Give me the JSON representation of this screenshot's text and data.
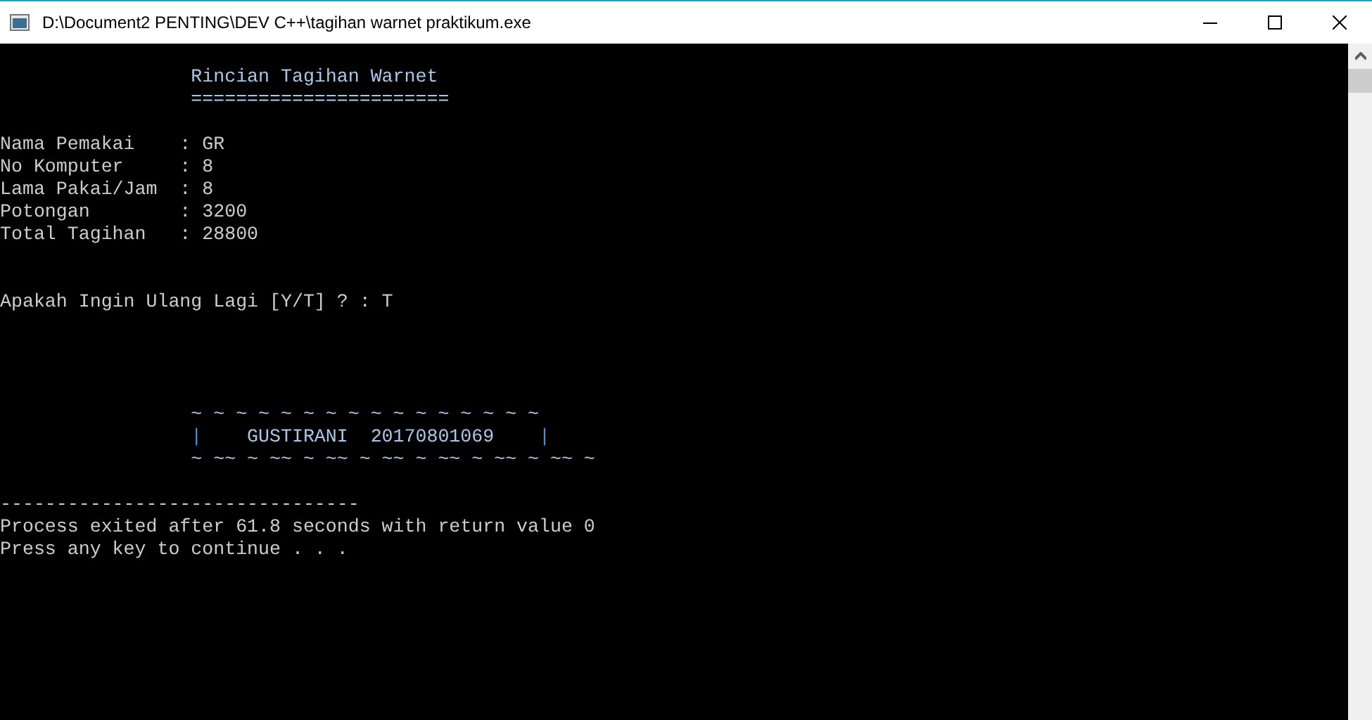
{
  "window": {
    "title": "D:\\Document2 PENTING\\DEV C++\\tagihan warnet praktikum.exe"
  },
  "console": {
    "lines": [
      {
        "kind": "blank"
      },
      {
        "kind": "heading",
        "text": "                 Rincian Tagihan Warnet"
      },
      {
        "kind": "heading",
        "text": "                 ======================="
      },
      {
        "kind": "blank"
      },
      {
        "kind": "text",
        "text": "Nama Pemakai    : GR"
      },
      {
        "kind": "text",
        "text": "No Komputer     : 8"
      },
      {
        "kind": "text",
        "text": "Lama Pakai/Jam  : 8"
      },
      {
        "kind": "text",
        "text": "Potongan        : 3200"
      },
      {
        "kind": "text",
        "text": "Total Tagihan   : 28800"
      },
      {
        "kind": "blank"
      },
      {
        "kind": "blank"
      },
      {
        "kind": "text",
        "text": "Apakah Ingin Ulang Lagi [Y/T] ? : T"
      },
      {
        "kind": "blank"
      },
      {
        "kind": "blank"
      },
      {
        "kind": "blank"
      },
      {
        "kind": "blank"
      },
      {
        "kind": "heading",
        "text": "                 ~ ~ ~ ~ ~ ~ ~ ~ ~ ~ ~ ~ ~ ~ ~ ~"
      },
      {
        "kind": "framed",
        "left": "|",
        "text": "    GUSTIRANI  20170801069    ",
        "right": "|"
      },
      {
        "kind": "heading",
        "text": "                 ~ ~~ ~ ~~ ~ ~~ ~ ~~ ~ ~~ ~ ~~ ~ ~~ ~"
      },
      {
        "kind": "blank"
      },
      {
        "kind": "text",
        "text": "--------------------------------"
      },
      {
        "kind": "text",
        "text": "Process exited after 61.8 seconds with return value 0"
      },
      {
        "kind": "text",
        "text": "Press any key to continue . . ."
      }
    ]
  }
}
